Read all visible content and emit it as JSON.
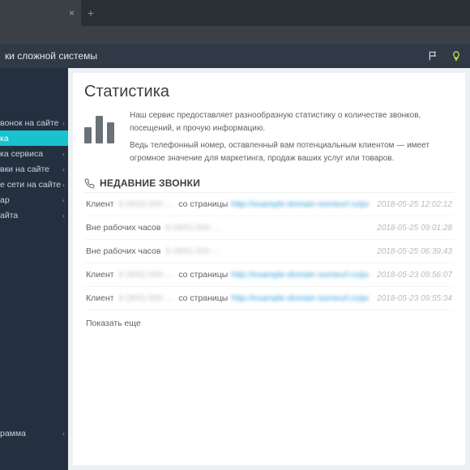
{
  "browser": {
    "tab_label": "",
    "tab_close": "×",
    "newtab": "+"
  },
  "titlebar": {
    "title": "ки сложной системы",
    "flag": "⚑",
    "bulb": "?"
  },
  "sidebar": {
    "items": [
      {
        "label": "вонок на сайте"
      },
      {
        "label": "ка"
      },
      {
        "label": "ка сервиса"
      },
      {
        "label": "вки на сайте"
      },
      {
        "label": "е сети на сайте"
      },
      {
        "label": "ар"
      },
      {
        "label": "айта"
      }
    ],
    "bottom": [
      {
        "label": "рамма"
      }
    ]
  },
  "main": {
    "heading": "Статистика",
    "info_line1": "Наш сервис предоставляет разнообразную статистику о количестве звонков, посещений, и прочую информацию.",
    "info_line2": "Ведь телефонный номер, оставленный вам потенциальным клиентом — имеет огромное значение для маркетинга, продаж ваших услуг или товаров.",
    "section_title": "НЕДАВНИЕ ЗВОНКИ",
    "client_label": "Клиент",
    "offhours_label": "Вне рабочих часов",
    "from_label": "со страницы",
    "phone_stub": "8 (900) 000-…",
    "link_stub": "http://example-domain-someurl.ru/page/",
    "show_more": "Показать еще",
    "calls": [
      {
        "type": "client",
        "ts": "2018-05-25 12:02:12"
      },
      {
        "type": "offhours",
        "ts": "2018-05-25 09:01:28"
      },
      {
        "type": "offhours",
        "ts": "2018-05-25 06:39:43"
      },
      {
        "type": "client",
        "ts": "2018-05-23 09:56:07"
      },
      {
        "type": "client",
        "ts": "2018-05-23 09:55:34"
      }
    ]
  }
}
